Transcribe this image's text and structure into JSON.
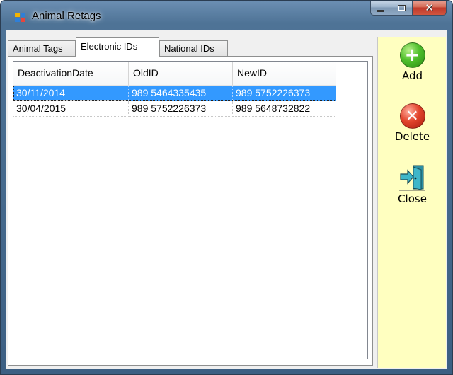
{
  "window": {
    "title": "Animal Retags",
    "minimize_glyph": "",
    "maximize_glyph": "",
    "close_glyph": "✕"
  },
  "tabs": [
    {
      "label": "Animal Tags"
    },
    {
      "label": "Electronic IDs"
    },
    {
      "label": "National IDs"
    }
  ],
  "active_tab": "Electronic IDs",
  "table": {
    "columns": [
      "DeactivationDate",
      "OldID",
      "NewID"
    ],
    "rows": [
      {
        "DeactivationDate": "30/11/2014",
        "OldID": "989 5464335435",
        "NewID": "989 5752226373",
        "selected": true
      },
      {
        "DeactivationDate": "30/04/2015",
        "OldID": "989 5752226373",
        "NewID": "989 5648732822",
        "selected": false
      }
    ]
  },
  "toolbar": {
    "add_label": "Add",
    "add_icon": "add-plus-icon",
    "delete_label": "Delete",
    "delete_icon": "delete-x-icon",
    "close_label": "Close",
    "close_icon": "exit-door-icon"
  },
  "colors": {
    "toolbar_bg": "#ffffc0",
    "selection": "#3399ff",
    "add_green": "#4fbf2c",
    "delete_red": "#e2442c",
    "door_teal": "#3fb6c9"
  }
}
